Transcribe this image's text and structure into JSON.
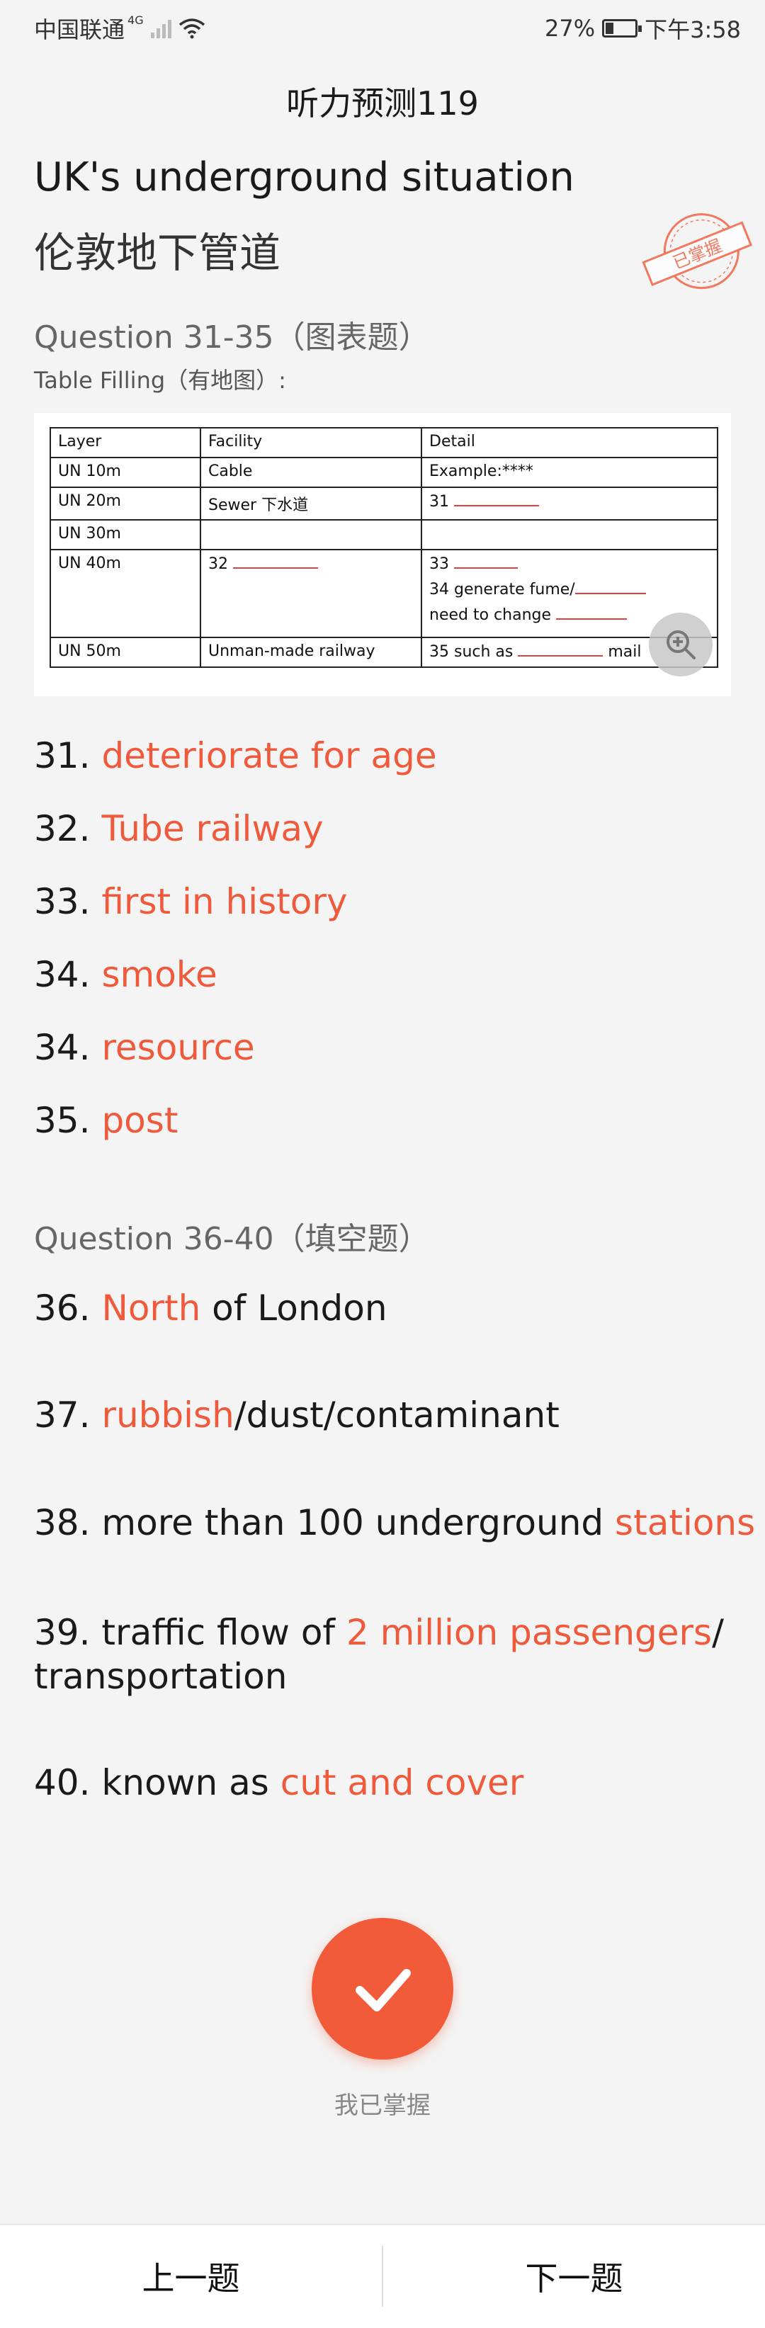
{
  "status_bar": {
    "carrier": "中国联通",
    "network": "4G",
    "battery_pct": "27%",
    "battery_level": 0.27,
    "time": "下午3:58"
  },
  "page_title": "听力预测119",
  "title_en": "UK's underground situation",
  "title_cn": "伦敦地下管道",
  "stamp_text": "已掌握",
  "section1": {
    "heading": "Question 31-35（图表题）",
    "subheading": "Table Filling（有地图）:"
  },
  "table": {
    "headers": [
      "Layer",
      "Facility",
      "Detail"
    ],
    "rows": [
      {
        "layer": "UN 10m",
        "facility": "Cable",
        "detail": "Example:****"
      },
      {
        "layer": "UN 20m",
        "facility": "Sewer  下水道",
        "detail": "31"
      },
      {
        "layer": "UN 30m",
        "facility": "",
        "detail": ""
      },
      {
        "layer": "UN 40m",
        "facility": "32",
        "detail_lines": [
          "33",
          "34 generate fume/",
          "need to change"
        ]
      },
      {
        "layer": "UN 50m",
        "facility": "Unman-made railway",
        "detail_prefix": "35 such as",
        "detail_suffix": "mail"
      }
    ]
  },
  "answers1": [
    {
      "num": "31.",
      "text": "deteriorate for age"
    },
    {
      "num": "32.",
      "text": "Tube railway"
    },
    {
      "num": "33.",
      "text": "first in history"
    },
    {
      "num": "34.",
      "text": "smoke"
    },
    {
      "num": "34.",
      "text": "resource"
    },
    {
      "num": "35.",
      "text": "post"
    }
  ],
  "section2": {
    "heading": "Question 36-40（填空题）"
  },
  "answers2": {
    "a36": {
      "num": "36.",
      "red": "North",
      "rest": " of London"
    },
    "a37": {
      "num": "37.",
      "red": "rubbish",
      "rest": "/dust/contaminant"
    },
    "a38": {
      "num": "38.",
      "pre": " more than 100 underground ",
      "red": "stations"
    },
    "a39": {
      "num": "39.",
      "pre": "  traffic flow of ",
      "red": "2 million passengers",
      "post": "/ transportation"
    },
    "a40": {
      "num": "40.",
      "pre": " known as ",
      "red": "cut and cover"
    }
  },
  "mastered_label": "我已掌握",
  "nav": {
    "prev": "上一题",
    "next": "下一题"
  },
  "colors": {
    "accent": "#f25b3a",
    "answer": "#f05a3c"
  },
  "icons": {
    "check": "checkmark-icon",
    "zoom": "zoom-in-icon",
    "wifi": "wifi-icon",
    "signal": "signal-icon",
    "battery": "battery-icon"
  }
}
